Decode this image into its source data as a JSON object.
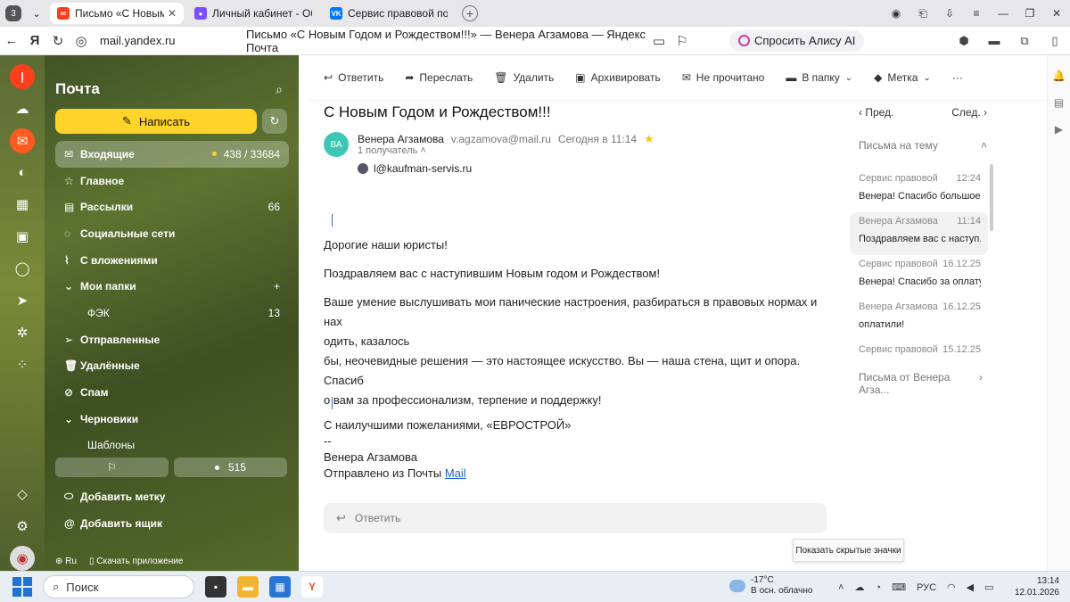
{
  "tabs": {
    "counter": "3",
    "items": [
      {
        "title": "Письмо «С Новым Год",
        "active": true
      },
      {
        "title": "Личный кабинет - Объяв",
        "active": false
      },
      {
        "title": "Сервис правовой помощ",
        "active": false
      }
    ]
  },
  "address": {
    "url": "mail.yandex.ru",
    "page_title": "Письмо «С Новым Годом и Рождеством!!!» — Венера Агзамова — Яндекс Почта",
    "alice": "Спросить Алису AI"
  },
  "panel": {
    "title": "Почта",
    "compose": "Написать",
    "folders": [
      {
        "label": "Входящие",
        "count": "438 / 33684",
        "icon": "✉",
        "selected": true,
        "dot": true
      },
      {
        "label": "Главное",
        "count": "",
        "icon": "☆"
      },
      {
        "label": "Рассылки",
        "count": "66",
        "icon": "▤"
      },
      {
        "label": "Социальные сети",
        "count": "",
        "icon": "◌"
      },
      {
        "label": "С вложениями",
        "count": "",
        "icon": "⌇"
      },
      {
        "label": "Мои папки",
        "count": "+",
        "icon": "⌄"
      },
      {
        "label": "ФЭК",
        "count": "13",
        "icon": "",
        "sub": true
      },
      {
        "label": "Отправленные",
        "count": "",
        "icon": "➢"
      },
      {
        "label": "Удалённые",
        "count": "",
        "icon": "🗑"
      },
      {
        "label": "Спам",
        "count": "",
        "icon": "⊘"
      },
      {
        "label": "Черновики",
        "count": "",
        "icon": "⌄"
      },
      {
        "label": "Шаблоны",
        "count": "",
        "icon": "",
        "sub": true
      }
    ],
    "unread_count": "515",
    "bottom": [
      {
        "label": "Добавить метку",
        "icon": "⬭"
      },
      {
        "label": "Добавить ящик",
        "icon": "@"
      }
    ],
    "lang": "Ru",
    "get_app": "Скачать приложение"
  },
  "toolbar": {
    "reply": "Ответить",
    "forward": "Переслать",
    "delete": "Удалить",
    "archive": "Архивировать",
    "unread": "Не прочитано",
    "to_folder": "В папку",
    "label": "Метка",
    "more": "···"
  },
  "message": {
    "subject": "С Новым Годом и Рождеством!!!",
    "avatar_initials": "ВА",
    "sender_name": "Венера Агзамова",
    "sender_email": "v.agzamova@mail.ru",
    "date": "Сегодня в 11:14",
    "recipients": "1 получатель",
    "to": "l@kaufman-servis.ru",
    "body": {
      "p1": "Дорогие наши юристы!",
      "p2": "Поздравляем вас с наступившим Новым годом и Рождеством!",
      "p3a": "Ваше умение выслушивать мои панические настроения, разбираться в правовых нормах и нах",
      "p3b": "одить, казалось",
      "p3c": "бы, неочевидные решения — это настоящее искусство. Вы — наша стена, щит и опора. Спасиб",
      "p3d": "о вам за профессионализм, терпение и поддержку!",
      "p4": "С наилучшими пожеланиями, «ЕВРОСТРОЙ»"
    },
    "signature": {
      "dashes": "--",
      "name": "Венера Агзамова",
      "sent_from": "Отправлено из Почты",
      "link": "Mail"
    },
    "quick_reply": "Ответить"
  },
  "thread": {
    "prev": "Пред.",
    "next": "След.",
    "heading": "Письма на тему",
    "items": [
      {
        "from": "Сервис правовой по...",
        "time": "12:24",
        "preview": "Венера! Спасибо большое ..."
      },
      {
        "from": "Венера Агзамова",
        "time": "11:14",
        "preview": "Поздравляем вас с наступ...",
        "selected": true
      },
      {
        "from": "Сервис правовой ...",
        "time": "16.12.25",
        "preview": "Венера! Спасибо за оплату"
      },
      {
        "from": "Венера Агзамова",
        "time": "16.12.25",
        "preview": "оплатили!"
      },
      {
        "from": "Сервис правовой ...",
        "time": "15.12.25",
        "preview": ""
      }
    ],
    "footer": "Письма от Венера Агза..."
  },
  "tooltip": "Показать скрытые значки",
  "taskbar": {
    "search": "Поиск",
    "temp": "-17°C",
    "weather": "В осн. облачно",
    "lang": "РУС",
    "time": "13:14",
    "date": "12.01.2026"
  }
}
